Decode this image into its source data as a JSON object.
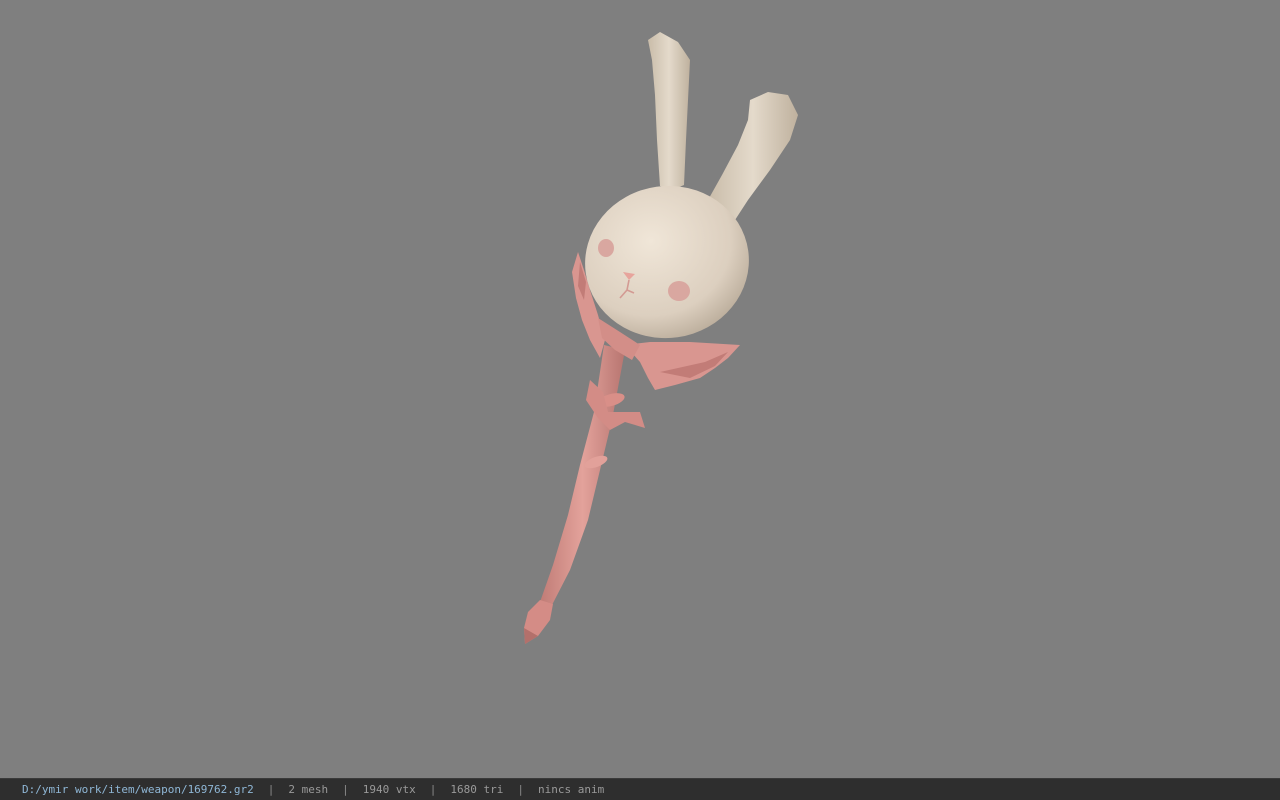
{
  "viewport": {
    "background_color": "#7f7f7f",
    "model": {
      "description_icon": "bunny-staff-model",
      "head_color": "#dcd0c0",
      "staff_color": "#d9948e"
    }
  },
  "statusbar": {
    "file_path": "D:/ymir work/item/weapon/169762.gr2",
    "mesh_count": "2 mesh",
    "vertex_count": "1940 vtx",
    "triangle_count": "1680 tri",
    "anim_status": "nincs anim",
    "separator": "|"
  }
}
